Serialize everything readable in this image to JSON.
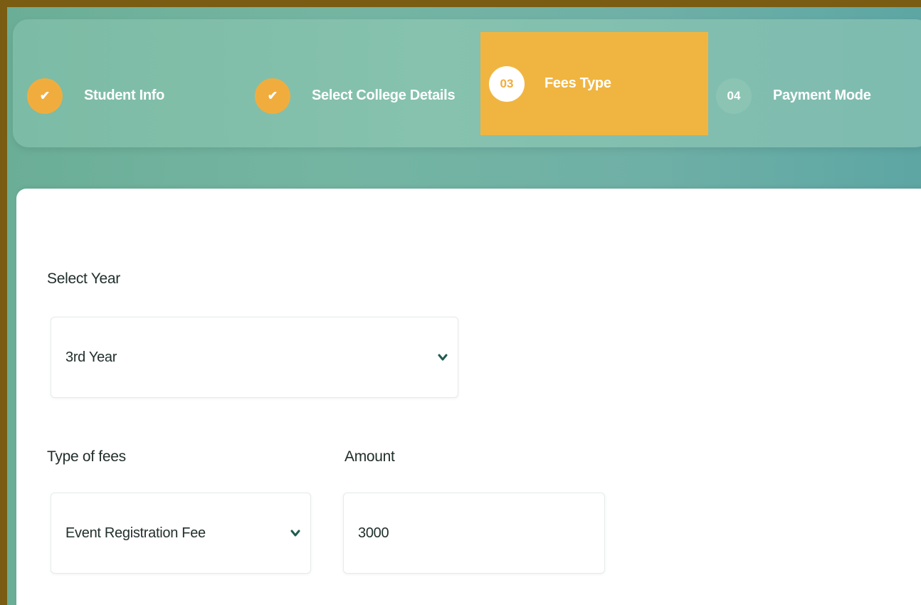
{
  "stepper": {
    "steps": [
      {
        "marker": "✔",
        "label": "Student Info",
        "state": "done"
      },
      {
        "marker": "✔",
        "label": "Select College Details",
        "state": "done"
      },
      {
        "marker": "03",
        "label": "Fees Type",
        "state": "active"
      },
      {
        "marker": "04",
        "label": "Payment Mode",
        "state": "pending"
      }
    ]
  },
  "form": {
    "year": {
      "label": "Select Year",
      "value": "3rd Year"
    },
    "fee_type": {
      "label": "Type of fees",
      "value": "Event Registration Fee"
    },
    "amount": {
      "label": "Amount",
      "value": "3000"
    }
  },
  "colors": {
    "accent": "#f0ad3e",
    "frame": "#7a5d12",
    "teal": "#6fb0a6",
    "chevron": "#1f5b4f"
  }
}
